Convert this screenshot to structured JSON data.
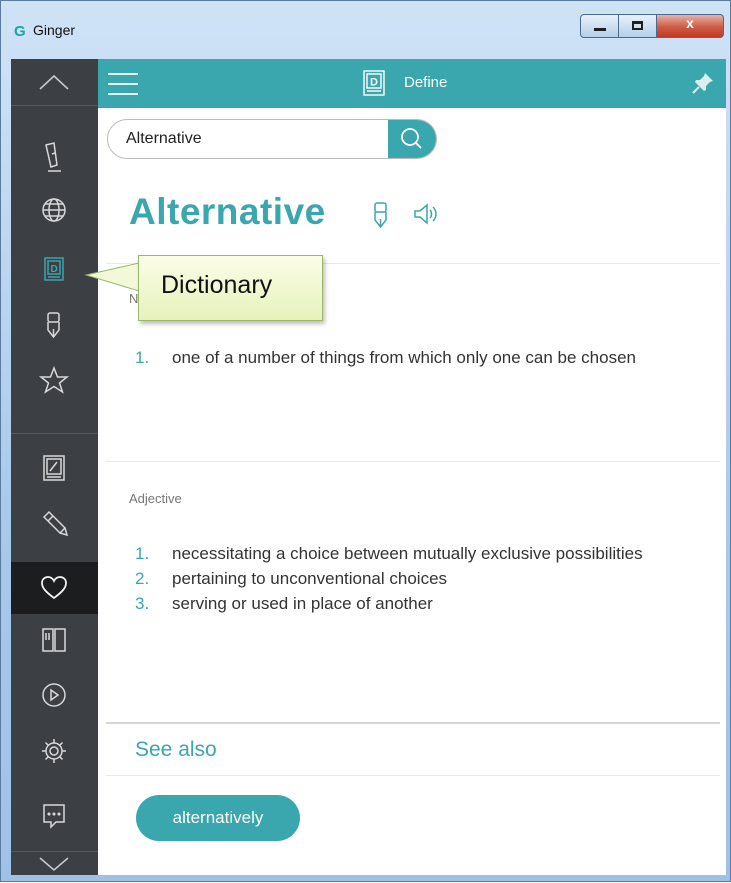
{
  "window": {
    "logo": "G",
    "title": "Ginger",
    "buttons": {
      "minimize": "minimize-icon",
      "maximize": "maximize-icon",
      "close": "x"
    }
  },
  "sidebar": {
    "scroll_up": "chevron-up-icon",
    "scroll_down": "chevron-down-icon",
    "items": [
      {
        "name": "rephrase",
        "icon": "pen-icon",
        "active": false
      },
      {
        "name": "translate",
        "icon": "globe-icon",
        "active": false
      },
      {
        "name": "dictionary",
        "icon": "dictionary-icon",
        "active": false
      },
      {
        "name": "writing",
        "icon": "fountain-pen-icon",
        "active": false
      },
      {
        "name": "favorites",
        "icon": "star-icon",
        "active": false
      },
      {
        "name": "personal-book",
        "icon": "notebook-icon",
        "active": false
      },
      {
        "name": "trainer",
        "icon": "eraser-pen-icon",
        "active": false
      },
      {
        "name": "love",
        "icon": "heart-icon",
        "active": true
      },
      {
        "name": "book",
        "icon": "open-book-icon",
        "active": false
      },
      {
        "name": "video",
        "icon": "play-circle-icon",
        "active": false
      },
      {
        "name": "settings",
        "icon": "gear-icon",
        "active": false
      },
      {
        "name": "feedback",
        "icon": "chat-icon",
        "active": false
      }
    ]
  },
  "topbar": {
    "menu_icon": "hamburger-icon",
    "title_icon": "D",
    "title": "Define",
    "pin_icon": "pin-icon"
  },
  "search": {
    "value": "Alternative",
    "button_icon": "search-icon"
  },
  "entry": {
    "headword": "Alternative",
    "pen_icon": "fountain-pen-icon",
    "audio_icon": "speaker-icon",
    "sections": [
      {
        "pos": "Noun",
        "definitions": [
          {
            "num": "1.",
            "text": "one of a number of things from which only one can be chosen"
          }
        ]
      },
      {
        "pos": "Adjective",
        "definitions": [
          {
            "num": "1.",
            "text": "necessitating a choice between mutually exclusive possibilities"
          },
          {
            "num": "2.",
            "text": "pertaining to unconventional choices"
          },
          {
            "num": "3.",
            "text": "serving or used in place of another"
          }
        ]
      }
    ]
  },
  "see_also": {
    "heading": "See also",
    "items": [
      "alternatively"
    ]
  },
  "tooltip": {
    "text": "Dictionary"
  },
  "colors": {
    "accent": "#3aa6ad",
    "sidebar_bg": "#3c3f43",
    "sidebar_active": "#1c1d1f",
    "tooltip_bg": "#eef6cc"
  }
}
